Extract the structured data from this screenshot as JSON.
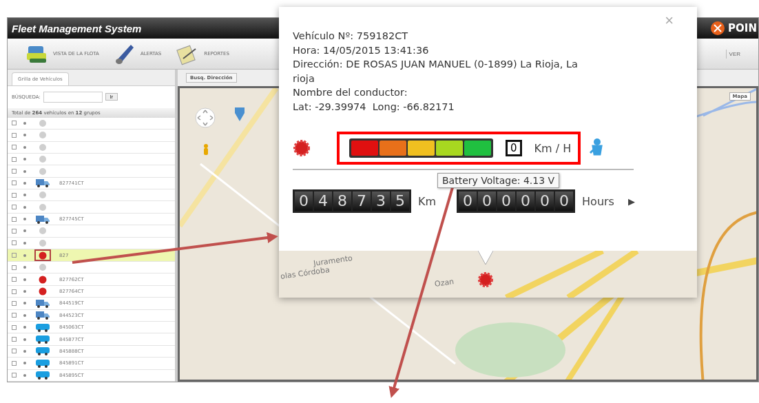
{
  "window": {
    "title": "Fleet Management System",
    "brand": "POIN"
  },
  "toolbar": [
    {
      "label": "VISTA DE LA FLOTA",
      "kind": "fleet"
    },
    {
      "label": "ALERTAS",
      "kind": "alerts"
    },
    {
      "label": "REPORTES",
      "kind": "reports"
    }
  ],
  "right_toolbar": {
    "label": "VER"
  },
  "sidebar": {
    "tab": "Grilla de Vehículos",
    "search_label": "BÚSQUEDA:",
    "go_button": "Ir",
    "summary": "Total de **264** vehículos en **12** grupos",
    "rows": [
      {
        "kind": "gray",
        "selected": false
      },
      {
        "kind": "gray",
        "selected": false
      },
      {
        "kind": "gray",
        "selected": false
      },
      {
        "kind": "gray",
        "selected": false
      },
      {
        "kind": "gray",
        "selected": false
      },
      {
        "kind": "truck",
        "selected": false,
        "plate": "827741CT"
      },
      {
        "kind": "gray",
        "selected": false
      },
      {
        "kind": "gray",
        "selected": false
      },
      {
        "kind": "truck",
        "selected": false,
        "plate": "827745CT"
      },
      {
        "kind": "gray",
        "selected": false
      },
      {
        "kind": "gray",
        "selected": false
      },
      {
        "kind": "red",
        "selected": true,
        "plate": "827"
      },
      {
        "kind": "gray",
        "selected": false
      },
      {
        "kind": "red",
        "selected": false,
        "plate": "827762CT"
      },
      {
        "kind": "red",
        "selected": false,
        "plate": "827764CT"
      },
      {
        "kind": "truck",
        "selected": false,
        "plate": "844519CT"
      },
      {
        "kind": "truck",
        "selected": false,
        "plate": "844523CT"
      },
      {
        "kind": "bus",
        "selected": false,
        "plate": "845063CT"
      },
      {
        "kind": "bus",
        "selected": false,
        "plate": "845877CT"
      },
      {
        "kind": "bus",
        "selected": false,
        "plate": "845888CT"
      },
      {
        "kind": "bus",
        "selected": false,
        "plate": "845891CT"
      },
      {
        "kind": "bus",
        "selected": false,
        "plate": "845895CT"
      }
    ]
  },
  "map": {
    "search_tab": "Busq. Dirección",
    "map_type": "Mapa"
  },
  "popup": {
    "map_labels": [
      "Juramento",
      "olas Córdoba",
      "Ozan"
    ],
    "close": "×",
    "lines": [
      "Vehículo Nº: 759182CT",
      "Hora: 14/05/2015 13:41:36",
      "Dirección: DE ROSAS JUAN MANUEL (0-1899) La Rioja, La rioja",
      "Nombre del conductor:",
      "Lat: -29.39974  Long: -66.82171"
    ],
    "battery": [
      {
        "color": "#e01010"
      },
      {
        "color": "#e8701a"
      },
      {
        "color": "#f0c020"
      },
      {
        "color": "#a8d820"
      },
      {
        "color": "#20c040"
      }
    ],
    "speed": "0",
    "speed_unit": "Km / H",
    "odometer": [
      "0",
      "4",
      "8",
      "7",
      "3",
      "5"
    ],
    "odometer_unit": "Km",
    "hours": [
      "0",
      "0",
      "0",
      "0",
      "0",
      "0"
    ],
    "hours_unit": "Hours",
    "next": "▶",
    "tooltip": "Battery Voltage: 4.13 V"
  }
}
